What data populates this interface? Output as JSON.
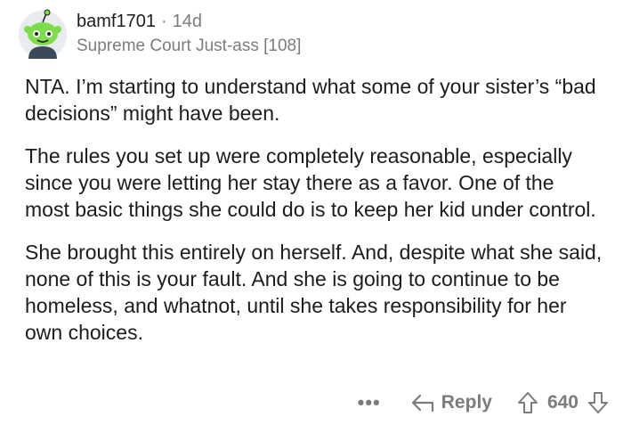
{
  "comment": {
    "username": "bamf1701",
    "separator": "·",
    "age": "14d",
    "flair": "Supreme Court Just-ass [108]",
    "paragraphs": [
      "NTA. I’m starting to understand what some of your sister’s “bad decisions” might have been.",
      "The rules you set up were completely reasonable, especially since you were letting her stay there as a favor. One of the most basic things she could do is to keep her kid under control.",
      "She brought this entirely on herself. And, despite what she said, none of this is your fault. And she is going to continue to be homeless, and whatnot, until she takes responsibility for her own choices."
    ],
    "actions": {
      "more_label": "•••",
      "reply_label": "Reply",
      "vote_count": "640"
    }
  },
  "icons": {
    "avatar": "snoo-avatar-icon",
    "reply": "reply-arrow-icon",
    "upvote": "upvote-arrow-icon",
    "downvote": "downvote-arrow-icon"
  },
  "colors": {
    "text": "#1c1c1c",
    "muted": "#7c7c7c",
    "avatar_green": "#7ddc4b"
  }
}
